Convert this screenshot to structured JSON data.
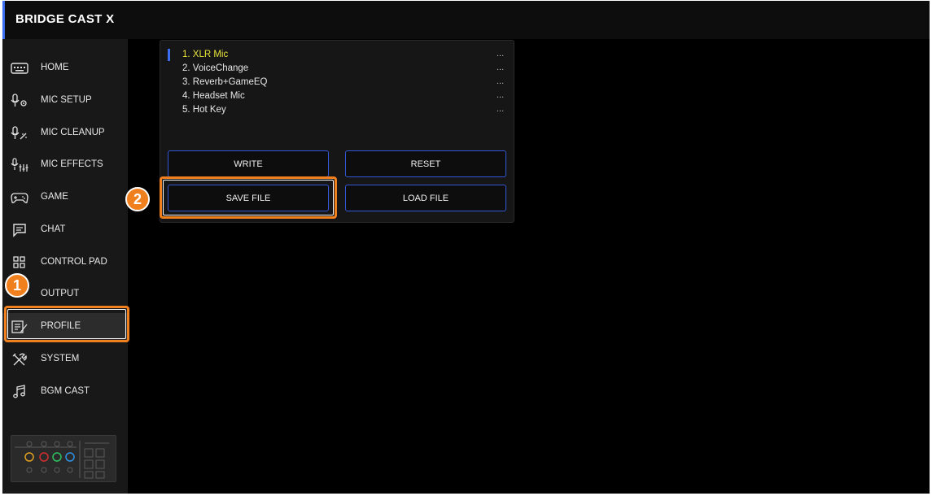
{
  "app": {
    "title": "BRIDGE CAST X"
  },
  "sidebar": {
    "items": [
      {
        "label": "HOME",
        "icon": "keyboard-icon"
      },
      {
        "label": "MIC SETUP",
        "icon": "mic-gear-icon"
      },
      {
        "label": "MIC CLEANUP",
        "icon": "mic-sparkle-icon"
      },
      {
        "label": "MIC EFFECTS",
        "icon": "mic-sliders-icon"
      },
      {
        "label": "GAME",
        "icon": "gamepad-icon"
      },
      {
        "label": "CHAT",
        "icon": "chat-bubble-icon"
      },
      {
        "label": "CONTROL PAD",
        "icon": "grid-icon"
      },
      {
        "label": "OUTPUT",
        "icon": "output-icon"
      },
      {
        "label": "PROFILE",
        "icon": "profile-edit-icon",
        "active": true
      },
      {
        "label": "SYSTEM",
        "icon": "tools-icon"
      },
      {
        "label": "BGM CAST",
        "icon": "music-note-icon"
      }
    ]
  },
  "profiles": {
    "items": [
      {
        "name": "1. XLR Mic",
        "more": "...",
        "selected": true
      },
      {
        "name": "2. VoiceChange",
        "more": "..."
      },
      {
        "name": "3. Reverb+GameEQ",
        "more": "..."
      },
      {
        "name": "4. Headset Mic",
        "more": "..."
      },
      {
        "name": "5. Hot Key",
        "more": "..."
      }
    ]
  },
  "buttons": {
    "write": "WRITE",
    "reset": "RESET",
    "save_file": "SAVE FILE",
    "load_file": "LOAD FILE"
  },
  "callouts": {
    "one": "1",
    "two": "2"
  },
  "colors": {
    "accent_blue": "#3a6df0",
    "highlight_orange": "#f07f1e",
    "selected_profile": "#e8e33a",
    "background": "#000000",
    "sidebar": "#181818"
  }
}
